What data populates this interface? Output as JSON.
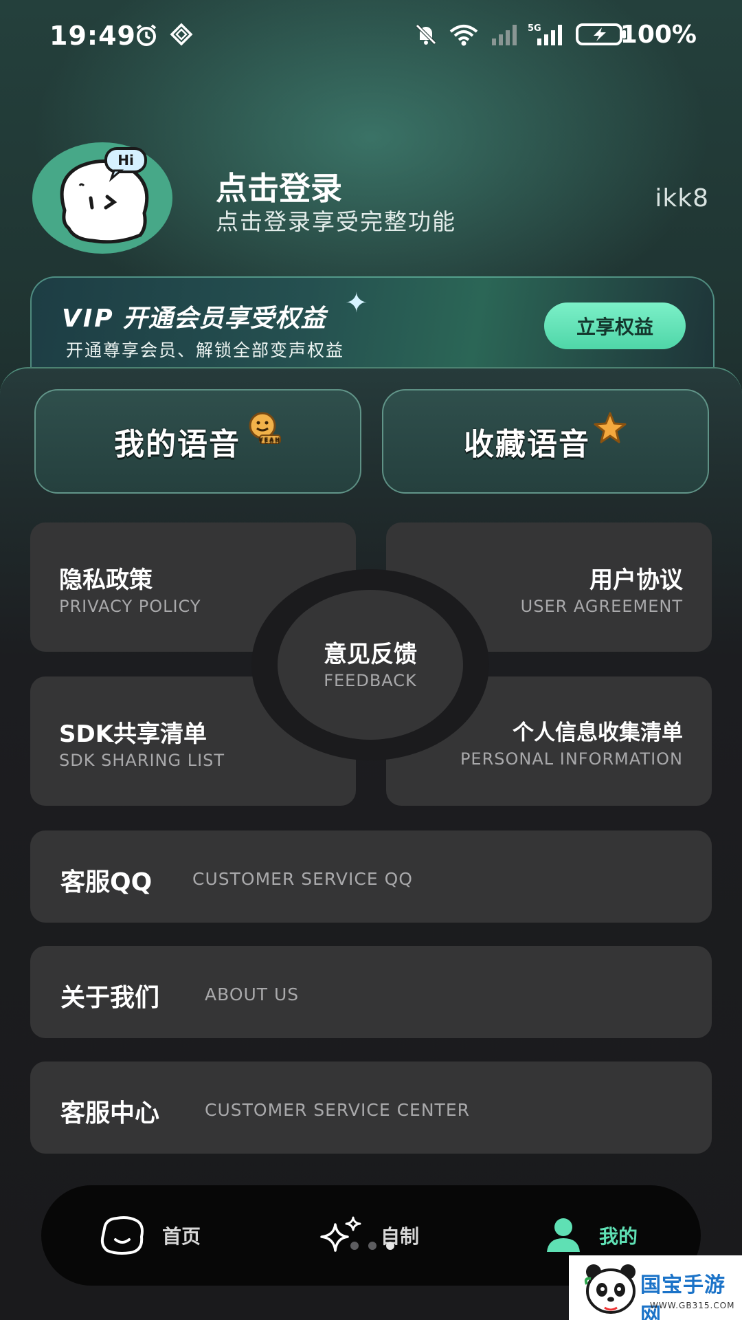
{
  "status_bar": {
    "time": "19:49",
    "battery": "100%",
    "icons": [
      "alarm-icon",
      "vpn-icon",
      "mute-icon",
      "wifi-icon",
      "signal-icon",
      "signal-5g-icon",
      "battery-charging-icon"
    ]
  },
  "profile": {
    "title": "点击登录",
    "subtitle": "点击登录享受完整功能",
    "code": "ikk8",
    "avatar_badge": "Hi"
  },
  "vip": {
    "mark": "VIP",
    "title": "开通会员享受权益",
    "subtitle": "开通尊享会员、解锁全部变声权益",
    "button": "立享权益"
  },
  "quick": {
    "my_voice": "我的语音",
    "my_voice_sticker": "YEAH",
    "fav_voice": "收藏语音"
  },
  "grid": {
    "privacy": {
      "zh": "隐私政策",
      "en": "PRIVACY POLICY"
    },
    "agreement": {
      "zh": "用户协议",
      "en": "USER AGREEMENT"
    },
    "feedback": {
      "zh": "意见反馈",
      "en": "FEEDBACK"
    },
    "sdk": {
      "zh": "SDK共享清单",
      "en": "SDK SHARING LIST"
    },
    "personal": {
      "zh": "个人信息收集清单",
      "en": "PERSONAL INFORMATION"
    }
  },
  "rows": [
    {
      "zh": "客服QQ",
      "en": "CUSTOMER SERVICE QQ"
    },
    {
      "zh": "关于我们",
      "en": "ABOUT US"
    },
    {
      "zh": "客服中心",
      "en": "CUSTOMER SERVICE CENTER"
    }
  ],
  "nav": {
    "home": "首页",
    "create": "自制",
    "mine": "我的",
    "active": "mine"
  },
  "colors": {
    "accent": "#5fe0b4",
    "card": "#353536",
    "nav_bg": "#070707"
  },
  "watermark": {
    "title": "国宝手游网",
    "url": "WWW.GB315.COM"
  }
}
